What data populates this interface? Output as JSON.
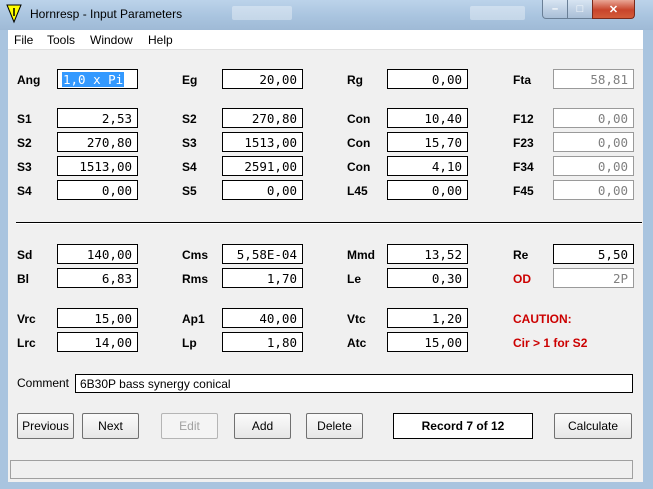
{
  "window": {
    "title": "Hornresp - Input Parameters",
    "controls": {
      "minimize": "–",
      "maximize": "□",
      "close": "✕"
    }
  },
  "menu": [
    "File",
    "Tools",
    "Window",
    "Help"
  ],
  "params": {
    "Ang": {
      "label": "Ang",
      "value": "1,0 x Pi"
    },
    "Eg": {
      "label": "Eg",
      "value": "20,00"
    },
    "Rg": {
      "label": "Rg",
      "value": "0,00"
    },
    "Fta": {
      "label": "Fta",
      "value": "58,81"
    },
    "S1": {
      "label": "S1",
      "value": "2,53"
    },
    "S2a": {
      "label": "S2",
      "value": "270,80"
    },
    "Con1": {
      "label": "Con",
      "value": "10,40"
    },
    "F12": {
      "label": "F12",
      "value": "0,00"
    },
    "S2b": {
      "label": "S2",
      "value": "270,80"
    },
    "S3a": {
      "label": "S3",
      "value": "1513,00"
    },
    "Con2": {
      "label": "Con",
      "value": "15,70"
    },
    "F23": {
      "label": "F23",
      "value": "0,00"
    },
    "S3b": {
      "label": "S3",
      "value": "1513,00"
    },
    "S4a": {
      "label": "S4",
      "value": "2591,00"
    },
    "Con3": {
      "label": "Con",
      "value": "4,10"
    },
    "F34": {
      "label": "F34",
      "value": "0,00"
    },
    "S4b": {
      "label": "S4",
      "value": "0,00"
    },
    "S5": {
      "label": "S5",
      "value": "0,00"
    },
    "L45": {
      "label": "L45",
      "value": "0,00"
    },
    "F45": {
      "label": "F45",
      "value": "0,00"
    },
    "Sd": {
      "label": "Sd",
      "value": "140,00"
    },
    "Cms": {
      "label": "Cms",
      "value": "5,58E-04"
    },
    "Mmd": {
      "label": "Mmd",
      "value": "13,52"
    },
    "Re": {
      "label": "Re",
      "value": "5,50"
    },
    "Bl": {
      "label": "Bl",
      "value": "6,83"
    },
    "Rms": {
      "label": "Rms",
      "value": "1,70"
    },
    "Le": {
      "label": "Le",
      "value": "0,30"
    },
    "OD": {
      "label": "OD",
      "value": "2P"
    },
    "Vrc": {
      "label": "Vrc",
      "value": "15,00"
    },
    "Ap1": {
      "label": "Ap1",
      "value": "40,00"
    },
    "Vtc": {
      "label": "Vtc",
      "value": "1,20"
    },
    "Lrc": {
      "label": "Lrc",
      "value": "14,00"
    },
    "Lp": {
      "label": "Lp",
      "value": "1,80"
    },
    "Atc": {
      "label": "Atc",
      "value": "15,00"
    }
  },
  "caution": {
    "title": "CAUTION:",
    "message": "Cir > 1 for S2"
  },
  "comment": {
    "label": "Comment",
    "value": "6B30P bass synergy  conical"
  },
  "buttons": {
    "previous": "Previous",
    "next": "Next",
    "edit": "Edit",
    "add": "Add",
    "delete": "Delete",
    "calculate": "Calculate"
  },
  "record": "Record 7 of 12",
  "colors": {
    "warning": "#cc0000",
    "selection": "#3399ff",
    "titlebar": "#a9c4df"
  }
}
